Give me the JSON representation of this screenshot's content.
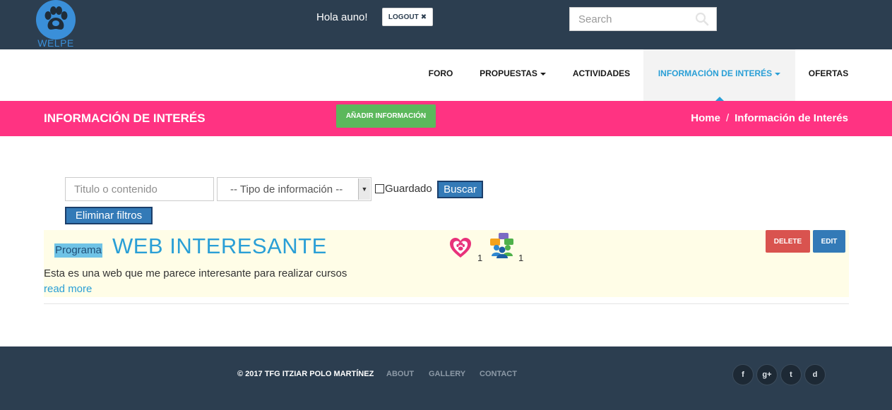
{
  "header": {
    "logo_text": "WELPE",
    "greeting": "Hola auno!",
    "logout_label": "LOGOUT",
    "search_placeholder": "Search"
  },
  "nav": {
    "items": [
      {
        "label": "FORO"
      },
      {
        "label": "PROPUESTAS"
      },
      {
        "label": "ACTIVIDADES"
      },
      {
        "label": "INFORMACIÓN DE INTERÉS"
      },
      {
        "label": "OFERTAS"
      }
    ],
    "active": "INFORMACIÓN DE INTERÉS"
  },
  "banner": {
    "title": "INFORMACIÓN DE INTERÉS",
    "add_button": "AÑADIR INFORMACIÓN",
    "breadcrumb_home": "Home",
    "breadcrumb_separator": "/",
    "breadcrumb_current": "Información de Interés"
  },
  "filters": {
    "text_placeholder": "Titulo o contenido",
    "type_selected": "-- Tipo de información --",
    "saved_label": "Guardado",
    "saved_checked": false,
    "search_button": "Buscar",
    "clear_button": "Eliminar filtros"
  },
  "posts": [
    {
      "tag": "Programa",
      "title": "WEB INTERESANTE",
      "description": "Esta es una web que me parece interesante para realizar cursos",
      "read_more": "read more",
      "favorites_count": "1",
      "comments_count": "1",
      "delete_label": "DELETE",
      "edit_label": "EDIT"
    }
  ],
  "footer": {
    "copyright": "© 2017 TFG ITZIAR POLO MARTÍNEZ",
    "links": [
      {
        "label": "ABOUT"
      },
      {
        "label": "GALLERY"
      },
      {
        "label": "CONTACT"
      }
    ],
    "social": [
      {
        "glyph": "f",
        "icon": "facebook-icon"
      },
      {
        "glyph": "g+",
        "icon": "google-plus-icon"
      },
      {
        "glyph": "t",
        "icon": "twitter-icon"
      },
      {
        "glyph": "d",
        "icon": "dribbble-icon"
      }
    ]
  },
  "colors": {
    "topbar": "#2c3e50",
    "accent_pink": "#ff3382",
    "link_blue": "#2a9fd6",
    "add_green": "#5cb85c",
    "delete_red": "#d9534f",
    "edit_blue": "#337ab7",
    "post_background": "#fffde7"
  }
}
